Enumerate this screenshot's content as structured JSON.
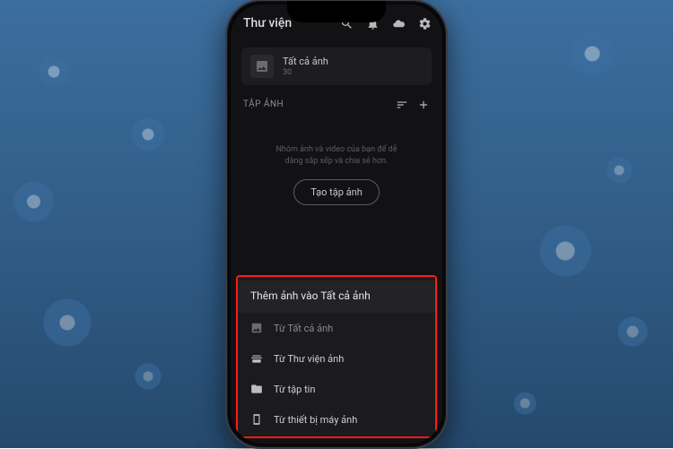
{
  "header": {
    "title": "Thư viện"
  },
  "album": {
    "name": "Tất cả ảnh",
    "count": "30"
  },
  "section": {
    "label": "TẬP ẢNH"
  },
  "empty": {
    "line1": "Nhóm ảnh và video của bạn để dễ",
    "line2": "dàng sắp xếp và chia sẻ hơn.",
    "create_button": "Tạo tập ảnh"
  },
  "sheet": {
    "title": "Thêm ảnh vào Tất cả ảnh",
    "items": [
      {
        "label": "Từ Tất cả ảnh",
        "icon": "image-icon"
      },
      {
        "label": "Từ Thư viện ảnh",
        "icon": "gallery-stack-icon"
      },
      {
        "label": "Từ tập tin",
        "icon": "folder-icon"
      },
      {
        "label": "Từ thiết bị máy ảnh",
        "icon": "camera-device-icon"
      }
    ]
  },
  "colors": {
    "highlight": "#ff1a1a",
    "bg_dark": "#121214"
  }
}
